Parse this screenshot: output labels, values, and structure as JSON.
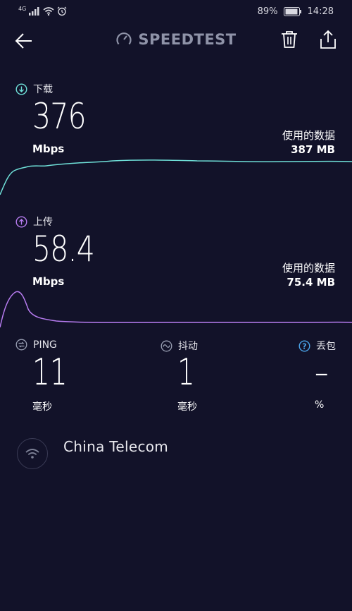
{
  "status_bar": {
    "network_type": "4G",
    "battery": "89%",
    "time": "14:28"
  },
  "header": {
    "title": "SPEEDTEST"
  },
  "download": {
    "label": "下载",
    "value": "376",
    "unit": "Mbps",
    "used_label": "使用的数据",
    "used_value": "387 MB"
  },
  "upload": {
    "label": "上传",
    "value": "58.4",
    "unit": "Mbps",
    "used_label": "使用的数据",
    "used_value": "75.4 MB"
  },
  "ping": {
    "label": "PING",
    "value": "11",
    "unit": "毫秒"
  },
  "jitter": {
    "label": "抖动",
    "value": "1",
    "unit": "毫秒"
  },
  "loss": {
    "label": "丢包",
    "value": "–",
    "unit": "%"
  },
  "isp": {
    "name": "China Telecom"
  },
  "colors": {
    "background": "#121229",
    "download": "#6fe0d8",
    "upload": "#b77cf0",
    "help": "#4aa3e8"
  }
}
